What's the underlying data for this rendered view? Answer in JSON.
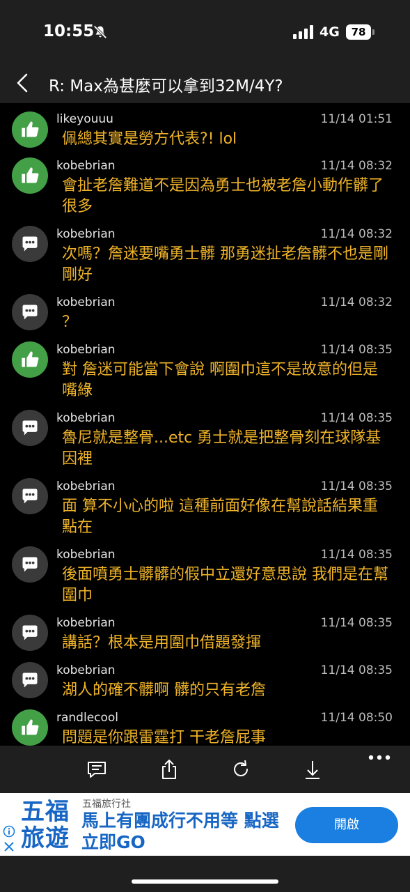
{
  "status_bar": {
    "time": "10:55",
    "network": "4G",
    "battery": "78"
  },
  "header": {
    "title": "R: Max為甚麼可以拿到32M/4Y?"
  },
  "comments": [
    {
      "type": "push",
      "user": "likeyouuu",
      "time": "11/14 01:51",
      "text": "佩總其實是勞方代表?! lol"
    },
    {
      "type": "push",
      "user": "kobebrian",
      "time": "11/14 08:32",
      "text": "會扯老詹難道不是因為勇士也被老詹小動作髒了很多"
    },
    {
      "type": "neutral",
      "user": "kobebrian",
      "time": "11/14 08:32",
      "text": "次嗎？詹迷要嘴勇士髒 那勇迷扯老詹髒不也是剛剛好"
    },
    {
      "type": "neutral",
      "user": "kobebrian",
      "time": "11/14 08:32",
      "text": "？"
    },
    {
      "type": "push",
      "user": "kobebrian",
      "time": "11/14 08:35",
      "text": "對 詹迷可能當下會說 啊圍巾這不是故意的但是嘴綠"
    },
    {
      "type": "neutral",
      "user": "kobebrian",
      "time": "11/14 08:35",
      "text": "魯尼就是整骨...etc 勇士就是把整骨刻在球隊基因裡"
    },
    {
      "type": "neutral",
      "user": "kobebrian",
      "time": "11/14 08:35",
      "text": "面 算不小心的啦 這種前面好像在幫說話結果重點在"
    },
    {
      "type": "neutral",
      "user": "kobebrian",
      "time": "11/14 08:35",
      "text": "後面噴勇士髒髒的假中立還好意思說 我們是在幫圍巾"
    },
    {
      "type": "neutral",
      "user": "kobebrian",
      "time": "11/14 08:35",
      "text": "講話？根本是用圍巾借題發揮"
    },
    {
      "type": "neutral",
      "user": "kobebrian",
      "time": "11/14 08:35",
      "text": "湖人的確不髒啊 髒的只有老詹"
    },
    {
      "type": "push",
      "user": "randlecool",
      "time": "11/14 08:50",
      "text": "問題是你跟雷霆打 干老詹屁事"
    }
  ],
  "toolbar": {
    "icons": [
      "comment-icon",
      "share-icon",
      "refresh-icon",
      "download-icon",
      "more-icon"
    ]
  },
  "ad": {
    "logo_line1": "五福",
    "logo_line2": "旅遊",
    "sponsor": "五福旅行社",
    "headline": "馬上有團成行不用等 點選立即GO",
    "cta": "開啟",
    "brand_color": "#1766c4"
  },
  "colors": {
    "comment_text": "#f0b429",
    "push_avatar": "#43a047",
    "neutral_avatar": "#3a3a3a",
    "bar_bg": "#1f1f1f"
  }
}
